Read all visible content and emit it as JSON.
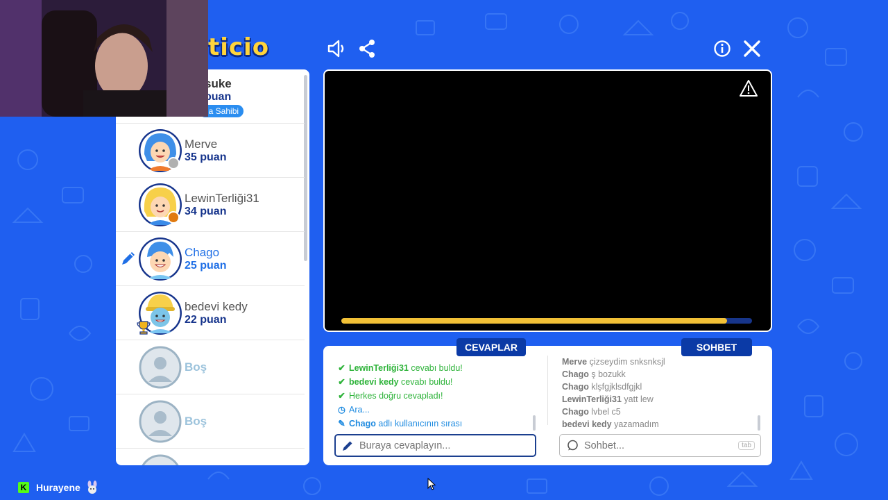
{
  "logo_text": "ticio",
  "colors": {
    "background": "#1f5ff0",
    "accent_dark_blue": "#16348c",
    "active_blue": "#1f6fe6",
    "timer_fill": "#f1c036",
    "success_green": "#2eb33a"
  },
  "toolbar": {
    "sound_icon": "speaker-icon",
    "share_icon": "share-icon",
    "info_icon": "info-icon",
    "close_icon": "close-icon",
    "report_icon": "warning-icon"
  },
  "players": [
    {
      "name": "suke",
      "score": "puan",
      "badge": "da Sahibi",
      "state": "partial"
    },
    {
      "name": "Merve",
      "score": "35 puan",
      "status_color": "#b0b0b0"
    },
    {
      "name": "LewinTerliği31",
      "score": "34 puan",
      "status_color": "#e07a10"
    },
    {
      "name": "Chago",
      "score": "25 puan",
      "drawing": true
    },
    {
      "name": "bedevi kedy",
      "score": "22 puan",
      "trophy": true
    },
    {
      "name": "Boş"
    },
    {
      "name": "Boş"
    }
  ],
  "timer": {
    "progress": 0.94
  },
  "tabs": {
    "answers_label": "CEVAPLAR",
    "chat_label": "SOHBET"
  },
  "answers_log": [
    {
      "user": "LewinTerliği31",
      "text": " cevabı buldu!",
      "type": "correct"
    },
    {
      "user": "bedevi kedy",
      "text": " cevabı buldu!",
      "type": "correct"
    },
    {
      "user": "",
      "text": "Herkes doğru cevapladı!",
      "type": "correct"
    },
    {
      "user": "",
      "text": "Ara...",
      "type": "clock"
    },
    {
      "user": "Chago",
      "text": " adlı kullanıcının sırası",
      "type": "pencil"
    }
  ],
  "chat_log": [
    {
      "user": "Merve",
      "text": "çizseydim snksnksjl"
    },
    {
      "user": "Chago",
      "text": "ş bozukk"
    },
    {
      "user": "Chago",
      "text": "klşfgjklsdfgjkl"
    },
    {
      "user": "LewinTerliği31",
      "text": "yatt lew"
    },
    {
      "user": "Chago",
      "text": "lvbel c5"
    },
    {
      "user": "bedevi kedy",
      "text": "yazamadım"
    }
  ],
  "answer_input": {
    "placeholder": "Buraya cevaplayın..."
  },
  "chat_input": {
    "placeholder": "Sohbet...",
    "key_hint": "tab"
  },
  "streamer": {
    "name": "Hurayene",
    "platform_logo": "K"
  }
}
